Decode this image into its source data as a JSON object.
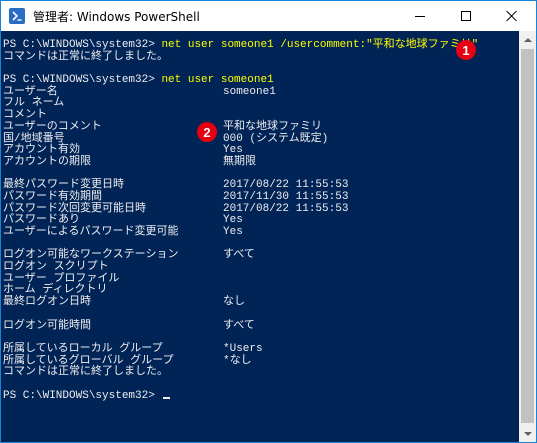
{
  "window": {
    "title": "管理者: Windows PowerShell",
    "icon": "powershell-icon",
    "controls": [
      "minimize-icon",
      "maximize-icon",
      "close-icon"
    ]
  },
  "console": {
    "lines": [
      {
        "kind": "cmd",
        "prompt": "PS C:\\WINDOWS\\system32> ",
        "command": "net user someone1 /usercomment:\"平和な地球ファミリ\""
      },
      {
        "kind": "text",
        "text": "コマンドは正常に終了しました。"
      },
      {
        "kind": "blank"
      },
      {
        "kind": "cmd",
        "prompt": "PS C:\\WINDOWS\\system32> ",
        "command": "net user someone1"
      },
      {
        "kind": "kv",
        "field": "ユーザー名",
        "value": "someone1"
      },
      {
        "kind": "kv",
        "field": "フル ネーム",
        "value": ""
      },
      {
        "kind": "kv",
        "field": "コメント",
        "value": ""
      },
      {
        "kind": "kv",
        "field": "ユーザーのコメント",
        "value": "平和な地球ファミリ"
      },
      {
        "kind": "kv",
        "field": "国/地域番号",
        "value": "000 (システム既定)"
      },
      {
        "kind": "kv",
        "field": "アカウント有効",
        "value": "Yes"
      },
      {
        "kind": "kv",
        "field": "アカウントの期限",
        "value": "無期限"
      },
      {
        "kind": "blank"
      },
      {
        "kind": "kv",
        "field": "最終パスワード変更日時",
        "value": "2017/08/22 11:55:53"
      },
      {
        "kind": "kv",
        "field": "パスワード有効期間",
        "value": "2017/11/30 11:55:53"
      },
      {
        "kind": "kv",
        "field": "パスワード次回変更可能日時",
        "value": "2017/08/22 11:55:53"
      },
      {
        "kind": "kv",
        "field": "パスワードあり",
        "value": "Yes"
      },
      {
        "kind": "kv",
        "field": "ユーザーによるパスワード変更可能",
        "value": "Yes"
      },
      {
        "kind": "blank"
      },
      {
        "kind": "kv",
        "field": "ログオン可能なワークステーション",
        "value": "すべて"
      },
      {
        "kind": "kv",
        "field": "ログオン スクリプト",
        "value": ""
      },
      {
        "kind": "kv",
        "field": "ユーザー プロファイル",
        "value": ""
      },
      {
        "kind": "kv",
        "field": "ホーム ディレクトリ",
        "value": ""
      },
      {
        "kind": "kv",
        "field": "最終ログオン日時",
        "value": "なし"
      },
      {
        "kind": "blank"
      },
      {
        "kind": "kv",
        "field": "ログオン可能時間",
        "value": "すべて"
      },
      {
        "kind": "blank"
      },
      {
        "kind": "kv",
        "field": "所属しているローカル グループ",
        "value": "*Users"
      },
      {
        "kind": "kv",
        "field": "所属しているグローバル グループ",
        "value": "*なし"
      },
      {
        "kind": "text",
        "text": "コマンドは正常に終了しました。"
      },
      {
        "kind": "blank"
      },
      {
        "kind": "prompt",
        "prompt": "PS C:\\WINDOWS\\system32> "
      }
    ]
  },
  "annotations": {
    "badge1": "1",
    "badge2": "2"
  },
  "colors": {
    "console_bg": "#012456",
    "console_fg": "#eeedf0",
    "command_fg": "#ffff00",
    "badge_bg": "#e60012",
    "border": "#1883d7"
  }
}
